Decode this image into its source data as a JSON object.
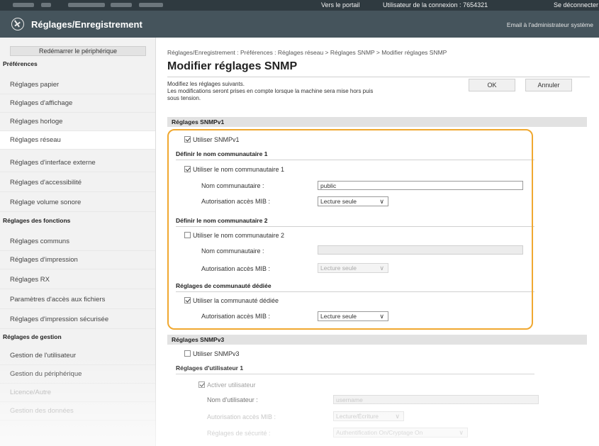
{
  "topbar": {
    "portal_link": "Vers le portail",
    "login_user": "Utilisateur de la connexion : 7654321",
    "logout": "Se déconnecter"
  },
  "header": {
    "title": "Réglages/Enregistrement",
    "admin_email": "Email à l'administrateur système"
  },
  "sidebar": {
    "restart_button": "Redémarrer le périphérique",
    "sections": {
      "preferences": "Préférences",
      "function_settings": "Réglages des fonctions",
      "management_settings": "Réglages de gestion"
    },
    "items": [
      "Réglages papier",
      "Réglages d'affichage",
      "Réglages horloge",
      "Réglages réseau",
      "Réglages d'interface externe",
      "Réglages d'accessibilité",
      "Réglage volume sonore",
      "Réglages communs",
      "Réglages d'impression",
      "Réglages RX",
      "Paramètres d'accès aux fichiers",
      "Réglages d'impression sécurisée",
      "Gestion de l'utilisateur",
      "Gestion du périphérique",
      "Licence/Autre",
      "Gestion des données"
    ]
  },
  "main": {
    "breadcrumb": "Réglages/Enregistrement : Préférences : Réglages réseau > Réglages SNMP > Modifier réglages SNMP",
    "page_title": "Modifier réglages SNMP",
    "instructions": [
      "Modifiez les réglages suivants.",
      "Les modifications seront prises en compte lorsque la machine sera mise hors puis",
      "sous tension."
    ],
    "ok_button": "OK",
    "cancel_button": "Annuler",
    "snmpv1": {
      "header": "Réglages SNMPv1",
      "use_snmpv1": "Utiliser SNMPv1",
      "community1": {
        "header": "Définir le nom communautaire 1",
        "use_label": "Utiliser le nom communautaire 1",
        "name_label": "Nom communautaire :",
        "name_value": "public",
        "mib_label": "Autorisation accès MIB :",
        "mib_value": "Lecture seule"
      },
      "community2": {
        "header": "Définir le nom communautaire 2",
        "use_label": "Utiliser le nom communautaire 2",
        "name_label": "Nom communautaire :",
        "name_value": "",
        "mib_label": "Autorisation accès MIB :",
        "mib_value": "Lecture seule"
      },
      "dedicated": {
        "header": "Réglages de communauté dédiée",
        "use_label": "Utiliser la communauté dédiée",
        "mib_label": "Autorisation accès MIB :",
        "mib_value": "Lecture seule"
      }
    },
    "snmpv3": {
      "header": "Réglages SNMPv3",
      "use_snmpv3": "Utiliser SNMPv3",
      "user1": {
        "header": "Réglages d'utilisateur 1",
        "enable_label": "Activer utilisateur",
        "username_label": "Nom d'utilisateur :",
        "username_value": "username",
        "mib_label": "Autorisation accès MIB :",
        "mib_value": "Lecture/Écriture",
        "security_label": "Réglages de sécurité :",
        "security_value": "Authentification On/Cryptage On"
      }
    }
  },
  "chevron_glyph": "∨",
  "colors": {
    "highlight_border": "#f0a830",
    "header_bg": "#45545c",
    "topbar_bg": "#2f3a40"
  }
}
